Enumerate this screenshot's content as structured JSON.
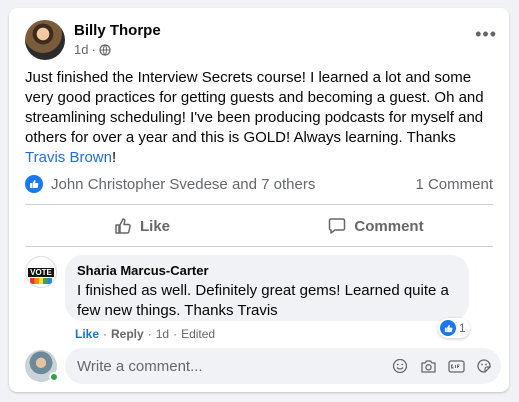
{
  "post": {
    "author": "Billy Thorpe",
    "time": "1d",
    "separator": "·",
    "text": "Just finished the Interview Secrets course! I learned a lot and some very good practices for getting guests and becoming a guest. Oh and streamlining scheduling! I've been producing podcasts for myself and others for over a year and this is GOLD! Always learning. Thanks ",
    "mention": "Travis Brown",
    "text_end": "!",
    "more_label": "•••"
  },
  "reactions": {
    "people": "John Christopher Svedese and 7 others",
    "comment_count": "1 Comment"
  },
  "actions": {
    "like": "Like",
    "comment": "Comment"
  },
  "comment": {
    "avatar_text": "VOTE",
    "author": "Sharia Marcus-Carter",
    "text": "I finished as well. Definitely great gems! Learned quite a few new things. Thanks Travis",
    "like_label": "Like",
    "reply_label": "Reply",
    "time": "1d",
    "edited": "Edited",
    "dot": "·",
    "reaction_count": "1"
  },
  "composer": {
    "placeholder": "Write a comment..."
  },
  "colors": {
    "accent": "#1877f2",
    "link": "#216fdb",
    "secondary_text": "#65676b"
  },
  "icons": [
    "globe-icon",
    "more-icon",
    "like-icon",
    "comment-icon",
    "emoji-icon",
    "camera-icon",
    "gif-icon",
    "sticker-icon"
  ]
}
